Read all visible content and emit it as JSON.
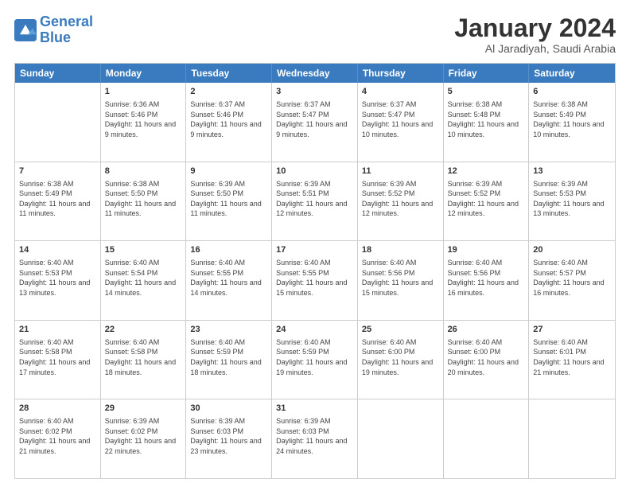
{
  "logo": {
    "line1": "General",
    "line2": "Blue"
  },
  "header": {
    "month": "January 2024",
    "location": "Al Jaradiyah, Saudi Arabia"
  },
  "days": [
    "Sunday",
    "Monday",
    "Tuesday",
    "Wednesday",
    "Thursday",
    "Friday",
    "Saturday"
  ],
  "weeks": [
    [
      {
        "day": "",
        "sunrise": "",
        "sunset": "",
        "daylight": ""
      },
      {
        "day": "1",
        "sunrise": "Sunrise: 6:36 AM",
        "sunset": "Sunset: 5:46 PM",
        "daylight": "Daylight: 11 hours and 9 minutes."
      },
      {
        "day": "2",
        "sunrise": "Sunrise: 6:37 AM",
        "sunset": "Sunset: 5:46 PM",
        "daylight": "Daylight: 11 hours and 9 minutes."
      },
      {
        "day": "3",
        "sunrise": "Sunrise: 6:37 AM",
        "sunset": "Sunset: 5:47 PM",
        "daylight": "Daylight: 11 hours and 9 minutes."
      },
      {
        "day": "4",
        "sunrise": "Sunrise: 6:37 AM",
        "sunset": "Sunset: 5:47 PM",
        "daylight": "Daylight: 11 hours and 10 minutes."
      },
      {
        "day": "5",
        "sunrise": "Sunrise: 6:38 AM",
        "sunset": "Sunset: 5:48 PM",
        "daylight": "Daylight: 11 hours and 10 minutes."
      },
      {
        "day": "6",
        "sunrise": "Sunrise: 6:38 AM",
        "sunset": "Sunset: 5:49 PM",
        "daylight": "Daylight: 11 hours and 10 minutes."
      }
    ],
    [
      {
        "day": "7",
        "sunrise": "Sunrise: 6:38 AM",
        "sunset": "Sunset: 5:49 PM",
        "daylight": "Daylight: 11 hours and 11 minutes."
      },
      {
        "day": "8",
        "sunrise": "Sunrise: 6:38 AM",
        "sunset": "Sunset: 5:50 PM",
        "daylight": "Daylight: 11 hours and 11 minutes."
      },
      {
        "day": "9",
        "sunrise": "Sunrise: 6:39 AM",
        "sunset": "Sunset: 5:50 PM",
        "daylight": "Daylight: 11 hours and 11 minutes."
      },
      {
        "day": "10",
        "sunrise": "Sunrise: 6:39 AM",
        "sunset": "Sunset: 5:51 PM",
        "daylight": "Daylight: 11 hours and 12 minutes."
      },
      {
        "day": "11",
        "sunrise": "Sunrise: 6:39 AM",
        "sunset": "Sunset: 5:52 PM",
        "daylight": "Daylight: 11 hours and 12 minutes."
      },
      {
        "day": "12",
        "sunrise": "Sunrise: 6:39 AM",
        "sunset": "Sunset: 5:52 PM",
        "daylight": "Daylight: 11 hours and 12 minutes."
      },
      {
        "day": "13",
        "sunrise": "Sunrise: 6:39 AM",
        "sunset": "Sunset: 5:53 PM",
        "daylight": "Daylight: 11 hours and 13 minutes."
      }
    ],
    [
      {
        "day": "14",
        "sunrise": "Sunrise: 6:40 AM",
        "sunset": "Sunset: 5:53 PM",
        "daylight": "Daylight: 11 hours and 13 minutes."
      },
      {
        "day": "15",
        "sunrise": "Sunrise: 6:40 AM",
        "sunset": "Sunset: 5:54 PM",
        "daylight": "Daylight: 11 hours and 14 minutes."
      },
      {
        "day": "16",
        "sunrise": "Sunrise: 6:40 AM",
        "sunset": "Sunset: 5:55 PM",
        "daylight": "Daylight: 11 hours and 14 minutes."
      },
      {
        "day": "17",
        "sunrise": "Sunrise: 6:40 AM",
        "sunset": "Sunset: 5:55 PM",
        "daylight": "Daylight: 11 hours and 15 minutes."
      },
      {
        "day": "18",
        "sunrise": "Sunrise: 6:40 AM",
        "sunset": "Sunset: 5:56 PM",
        "daylight": "Daylight: 11 hours and 15 minutes."
      },
      {
        "day": "19",
        "sunrise": "Sunrise: 6:40 AM",
        "sunset": "Sunset: 5:56 PM",
        "daylight": "Daylight: 11 hours and 16 minutes."
      },
      {
        "day": "20",
        "sunrise": "Sunrise: 6:40 AM",
        "sunset": "Sunset: 5:57 PM",
        "daylight": "Daylight: 11 hours and 16 minutes."
      }
    ],
    [
      {
        "day": "21",
        "sunrise": "Sunrise: 6:40 AM",
        "sunset": "Sunset: 5:58 PM",
        "daylight": "Daylight: 11 hours and 17 minutes."
      },
      {
        "day": "22",
        "sunrise": "Sunrise: 6:40 AM",
        "sunset": "Sunset: 5:58 PM",
        "daylight": "Daylight: 11 hours and 18 minutes."
      },
      {
        "day": "23",
        "sunrise": "Sunrise: 6:40 AM",
        "sunset": "Sunset: 5:59 PM",
        "daylight": "Daylight: 11 hours and 18 minutes."
      },
      {
        "day": "24",
        "sunrise": "Sunrise: 6:40 AM",
        "sunset": "Sunset: 5:59 PM",
        "daylight": "Daylight: 11 hours and 19 minutes."
      },
      {
        "day": "25",
        "sunrise": "Sunrise: 6:40 AM",
        "sunset": "Sunset: 6:00 PM",
        "daylight": "Daylight: 11 hours and 19 minutes."
      },
      {
        "day": "26",
        "sunrise": "Sunrise: 6:40 AM",
        "sunset": "Sunset: 6:00 PM",
        "daylight": "Daylight: 11 hours and 20 minutes."
      },
      {
        "day": "27",
        "sunrise": "Sunrise: 6:40 AM",
        "sunset": "Sunset: 6:01 PM",
        "daylight": "Daylight: 11 hours and 21 minutes."
      }
    ],
    [
      {
        "day": "28",
        "sunrise": "Sunrise: 6:40 AM",
        "sunset": "Sunset: 6:02 PM",
        "daylight": "Daylight: 11 hours and 21 minutes."
      },
      {
        "day": "29",
        "sunrise": "Sunrise: 6:39 AM",
        "sunset": "Sunset: 6:02 PM",
        "daylight": "Daylight: 11 hours and 22 minutes."
      },
      {
        "day": "30",
        "sunrise": "Sunrise: 6:39 AM",
        "sunset": "Sunset: 6:03 PM",
        "daylight": "Daylight: 11 hours and 23 minutes."
      },
      {
        "day": "31",
        "sunrise": "Sunrise: 6:39 AM",
        "sunset": "Sunset: 6:03 PM",
        "daylight": "Daylight: 11 hours and 24 minutes."
      },
      {
        "day": "",
        "sunrise": "",
        "sunset": "",
        "daylight": ""
      },
      {
        "day": "",
        "sunrise": "",
        "sunset": "",
        "daylight": ""
      },
      {
        "day": "",
        "sunrise": "",
        "sunset": "",
        "daylight": ""
      }
    ]
  ]
}
